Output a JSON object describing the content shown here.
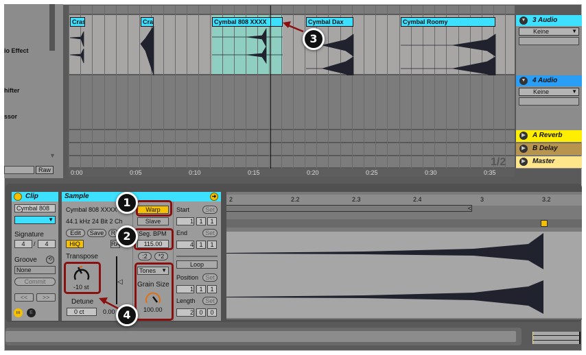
{
  "browser": {
    "items": [
      "io Effect",
      "hifter",
      "ssor"
    ],
    "raw_label": "Raw"
  },
  "arrangement": {
    "clips": [
      {
        "name": "Crash"
      },
      {
        "name": "Crash"
      },
      {
        "name": "Cymbal 808 XXXX"
      },
      {
        "name": "Cymbal Dax"
      },
      {
        "name": "Cymbal Roomy"
      }
    ],
    "ruler": [
      "0:00",
      "0:05",
      "0:10",
      "0:15",
      "0:20",
      "0:25",
      "0:30",
      "0:35"
    ],
    "page_indicator": "1/2"
  },
  "tracks": [
    {
      "name": "3 Audio",
      "input": "Keine",
      "color": "#3ee0ff"
    },
    {
      "name": "4 Audio",
      "input": "Keine",
      "color": "#2a9df4"
    },
    {
      "name": "A Reverb",
      "color": "#ffee00"
    },
    {
      "name": "B Delay",
      "color": "#b8954f"
    },
    {
      "name": "Master",
      "color": "#ffe68a"
    }
  ],
  "clip_panel": {
    "title": "Clip",
    "name": "Cymbal 808",
    "signature_label": "Signature",
    "sig_num": "4",
    "sig_sep": "/",
    "sig_den": "4",
    "groove_label": "Groove",
    "groove_value": "None",
    "commit": "Commit",
    "prev": "<<",
    "next": ">>"
  },
  "sample_panel": {
    "title": "Sample",
    "file": "Cymbal 808 XXXX",
    "info": "44.1 kHz 24 Bit 2 Ch",
    "edit": "Edit",
    "save": "Save",
    "rev": "R",
    "hiq": "HiQ",
    "ram": "RAM",
    "transpose_label": "Transpose",
    "transpose_value": "-10 st",
    "detune_label": "Detune",
    "detune_value": "0 ct",
    "gain_value": "0.00",
    "warp": "Warp",
    "slave": "Slave",
    "seg_bpm_label": "Seg. BPM",
    "seg_bpm": "115.00",
    "half": ":2",
    "double": "*2",
    "warp_mode": "Tones",
    "grain_label": "Grain Size",
    "grain_value": "100.00",
    "start_label": "Start",
    "start": [
      "1",
      "1",
      "1"
    ],
    "end_label": "End",
    "end": [
      "4",
      "1",
      "1"
    ],
    "set": "Set",
    "loop": "Loop",
    "position_label": "Position",
    "position": [
      "1",
      "1",
      "1"
    ],
    "length_label": "Length",
    "length": [
      "2",
      "0",
      "0"
    ]
  },
  "sample_editor": {
    "ruler": [
      "2",
      "2.2",
      "2.3",
      "2.4",
      "3",
      "3.2"
    ]
  },
  "annotations": [
    "1",
    "2",
    "3",
    "4"
  ]
}
